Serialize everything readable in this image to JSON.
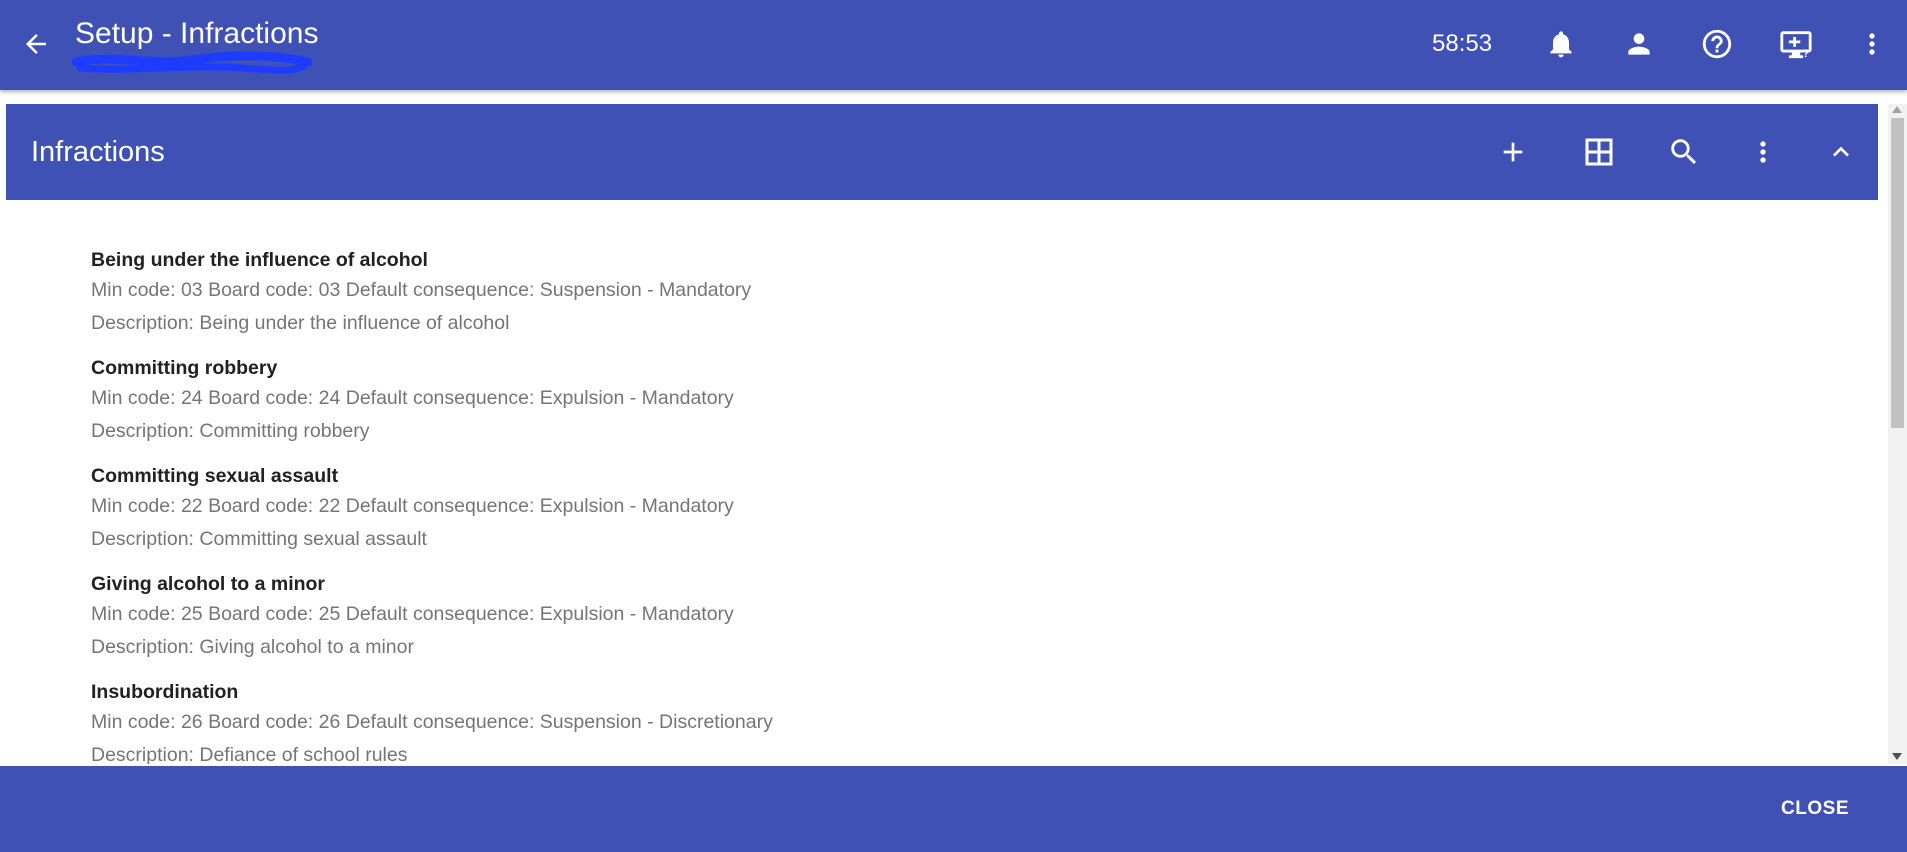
{
  "app_bar": {
    "title": "Setup - Infractions",
    "timer": "58:53",
    "icons": [
      "back-arrow-icon",
      "bell-icon",
      "person-icon",
      "help-circle-icon",
      "monitor-help-icon",
      "more-vert-icon"
    ]
  },
  "card": {
    "title": "Infractions",
    "toolbar_icons": [
      "plus-icon",
      "grid-icon",
      "search-icon",
      "more-vert-icon",
      "chevron-up-icon"
    ]
  },
  "items": [
    {
      "title": "Being under the influence of alcohol",
      "details": "Min code: 03 Board code: 03 Default consequence: Suspension - Mandatory",
      "description": "Description: Being under the influence of alcohol"
    },
    {
      "title": "Committing robbery",
      "details": "Min code: 24 Board code: 24 Default consequence: Expulsion - Mandatory",
      "description": "Description: Committing robbery"
    },
    {
      "title": "Committing sexual assault",
      "details": "Min code: 22 Board code: 22 Default consequence: Expulsion - Mandatory",
      "description": "Description: Committing sexual assault"
    },
    {
      "title": "Giving alcohol to a minor",
      "details": "Min code: 25 Board code: 25 Default consequence: Expulsion - Mandatory",
      "description": "Description: Giving alcohol to a minor"
    },
    {
      "title": "Insubordination",
      "details": "Min code: 26 Board code: 26 Default consequence: Suspension - Discretionary",
      "description": "Description: Defiance of school rules"
    }
  ],
  "footer": {
    "close_label": "CLOSE"
  },
  "colors": {
    "primary": "#3f51b5",
    "annotation_scribble": "#1e3cff",
    "item_title": "#212121",
    "item_text": "#757575"
  }
}
